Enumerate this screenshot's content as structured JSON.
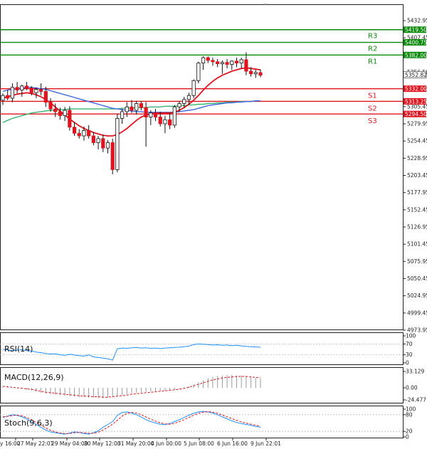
{
  "chart_data": {
    "type": "candlestick",
    "instrument_panels": [
      "main",
      "RSI",
      "MACD",
      "Stoch"
    ],
    "price_axis": {
      "ticks": [
        "5432.95",
        "5407.45",
        "5382.00",
        "5356.50",
        "5330.95",
        "5305.45",
        "5279.95",
        "5254.45",
        "5228.95",
        "5203.45",
        "5177.95",
        "5152.45",
        "5126.95",
        "5101.45",
        "5075.95",
        "5050.45",
        "5024.95",
        "4999.45",
        "4973.95"
      ],
      "min": 4973.95,
      "max": 5432.95
    },
    "levels": [
      {
        "label": "R3",
        "value": 5419.5,
        "value_text": "5419.50",
        "color": "#0a8a0a"
      },
      {
        "label": "R2",
        "value": 5400.75,
        "value_text": "5400.75",
        "color": "#0a8a0a"
      },
      {
        "label": "R1",
        "value": 5382.0,
        "value_text": "5382.00",
        "color": "#0a8a0a"
      },
      {
        "label": "S1",
        "value": 5332.0,
        "value_text": "5332.00",
        "color": "#e0141e"
      },
      {
        "label": "S2",
        "value": 5313.25,
        "value_text": "5313.25",
        "color": "#e0141e"
      },
      {
        "label": "S3",
        "value": 5294.5,
        "value_text": "5294.50",
        "color": "#e0141e"
      }
    ],
    "current_price": {
      "value": 5352.82,
      "value_text": "5352.82"
    },
    "time_axis": [
      "y 16:00",
      "27 May 22:01",
      "29 May 04:00",
      "30 May 12:00",
      "31 May 20:00",
      "4 Jun 00:00",
      "5 Jun 08:00",
      "6 Jun 16:00",
      "9 Jun 22:01"
    ],
    "candles": [
      [
        5315,
        5325,
        5308,
        5322
      ],
      [
        5322,
        5330,
        5315,
        5318
      ],
      [
        5318,
        5340,
        5312,
        5334
      ],
      [
        5334,
        5342,
        5325,
        5330
      ],
      [
        5330,
        5338,
        5320,
        5336
      ],
      [
        5336,
        5342,
        5330,
        5333
      ],
      [
        5333,
        5336,
        5322,
        5326
      ],
      [
        5326,
        5334,
        5318,
        5331
      ],
      [
        5331,
        5340,
        5322,
        5328
      ],
      [
        5328,
        5335,
        5305,
        5312
      ],
      [
        5312,
        5318,
        5298,
        5302
      ],
      [
        5302,
        5310,
        5290,
        5298
      ],
      [
        5298,
        5304,
        5286,
        5292
      ],
      [
        5292,
        5305,
        5284,
        5300
      ],
      [
        5300,
        5306,
        5270,
        5275
      ],
      [
        5275,
        5282,
        5262,
        5266
      ],
      [
        5266,
        5272,
        5258,
        5262
      ],
      [
        5262,
        5276,
        5255,
        5270
      ],
      [
        5270,
        5278,
        5258,
        5262
      ],
      [
        5262,
        5268,
        5248,
        5252
      ],
      [
        5252,
        5262,
        5242,
        5258
      ],
      [
        5258,
        5264,
        5238,
        5244
      ],
      [
        5244,
        5256,
        5236,
        5252
      ],
      [
        5252,
        5258,
        5205,
        5212
      ],
      [
        5212,
        5295,
        5208,
        5288
      ],
      [
        5288,
        5302,
        5280,
        5298
      ],
      [
        5298,
        5312,
        5290,
        5305
      ],
      [
        5305,
        5315,
        5296,
        5300
      ],
      [
        5300,
        5314,
        5294,
        5310
      ],
      [
        5310,
        5314,
        5300,
        5304
      ],
      [
        5304,
        5312,
        5246,
        5290
      ],
      [
        5290,
        5300,
        5278,
        5296
      ],
      [
        5296,
        5302,
        5284,
        5290
      ],
      [
        5290,
        5298,
        5276,
        5280
      ],
      [
        5280,
        5292,
        5266,
        5286
      ],
      [
        5286,
        5296,
        5272,
        5278
      ],
      [
        5278,
        5308,
        5274,
        5305
      ],
      [
        5305,
        5314,
        5298,
        5310
      ],
      [
        5310,
        5320,
        5304,
        5316
      ],
      [
        5316,
        5326,
        5308,
        5322
      ],
      [
        5322,
        5346,
        5318,
        5344
      ],
      [
        5344,
        5372,
        5340,
        5370
      ],
      [
        5370,
        5380,
        5360,
        5378
      ],
      [
        5378,
        5380,
        5370,
        5374
      ],
      [
        5374,
        5378,
        5366,
        5372
      ],
      [
        5372,
        5376,
        5364,
        5369
      ],
      [
        5369,
        5374,
        5354,
        5371
      ],
      [
        5371,
        5376,
        5362,
        5368
      ],
      [
        5368,
        5374,
        5360,
        5373
      ],
      [
        5373,
        5378,
        5364,
        5370
      ],
      [
        5370,
        5378,
        5362,
        5375
      ],
      [
        5375,
        5386,
        5352,
        5358
      ],
      [
        5358,
        5364,
        5350,
        5354
      ],
      [
        5354,
        5360,
        5348,
        5356
      ],
      [
        5356,
        5360,
        5349,
        5352
      ]
    ],
    "ma_fast": [
      5318,
      5320,
      5322,
      5324,
      5325,
      5326,
      5325,
      5323,
      5320,
      5316,
      5311,
      5305,
      5299,
      5293,
      5287,
      5282,
      5277,
      5273,
      5270,
      5267,
      5265,
      5263,
      5262,
      5262,
      5264,
      5268,
      5273,
      5279,
      5285,
      5290,
      5293,
      5295,
      5296,
      5296,
      5296,
      5296,
      5297,
      5300,
      5304,
      5309,
      5315,
      5322,
      5330,
      5337,
      5343,
      5348,
      5352,
      5355,
      5358,
      5360,
      5362,
      5363,
      5362,
      5361,
      5360
    ],
    "ma_mid": [
      5328,
      5330,
      5331,
      5332,
      5333,
      5334,
      5334,
      5333,
      5332,
      5331,
      5329,
      5327,
      5325,
      5323,
      5321,
      5319,
      5317,
      5315,
      5313,
      5311,
      5309,
      5307,
      5305,
      5303,
      5302,
      5301,
      5300,
      5299,
      5298,
      5298,
      5297,
      5297,
      5297,
      5297,
      5297,
      5297,
      5297,
      5298,
      5299,
      5300,
      5301,
      5303,
      5305,
      5307,
      5308,
      5309,
      5310,
      5311,
      5311,
      5312,
      5312,
      5313,
      5313,
      5314,
      5314
    ],
    "ma_slow": [
      5282,
      5285,
      5288,
      5290,
      5292,
      5294,
      5296,
      5297,
      5298,
      5299,
      5300,
      5300,
      5301,
      5301,
      5302,
      5302,
      5302,
      5302,
      5302,
      5302,
      5302,
      5302,
      5302,
      5302,
      5302,
      5303,
      5303,
      5303,
      5304,
      5304,
      5304,
      5305,
      5305,
      5305,
      5306,
      5306,
      5306,
      5307,
      5307,
      5308,
      5308,
      5309,
      5309,
      5310,
      5310,
      5311,
      5311,
      5312,
      5312,
      5312,
      5313,
      5313,
      5313,
      5314,
      5314
    ],
    "rsi": {
      "title": "RSI(14)",
      "ticks": [
        "100",
        "70",
        "30",
        "0"
      ],
      "values": [
        50,
        48,
        46,
        47,
        49,
        45,
        44,
        40,
        38,
        35,
        33,
        34,
        30,
        28,
        32,
        29,
        27,
        25,
        30,
        22,
        20,
        18,
        15,
        10,
        52,
        55,
        54,
        56,
        57,
        55,
        56,
        54,
        55,
        53,
        55,
        56,
        57,
        58,
        60,
        62,
        68,
        70,
        69,
        68,
        66,
        67,
        65,
        66,
        64,
        65,
        63,
        61,
        60,
        59,
        58
      ]
    },
    "macd": {
      "title": "MACD(12,26,9)",
      "ticks": [
        "33.129",
        "0.00",
        "-24.477"
      ],
      "histogram": [
        2,
        1,
        0,
        -1,
        -2,
        -4,
        -6,
        -8,
        -10,
        -12,
        -13,
        -14,
        -15,
        -16,
        -17,
        -18,
        -19,
        -19,
        -20,
        -20,
        -21,
        -21,
        -20,
        -19,
        -17,
        -15,
        -13,
        -11,
        -10,
        -9,
        -8,
        -7,
        -7,
        -6,
        -6,
        -5,
        -4,
        -2,
        0,
        3,
        7,
        11,
        15,
        19,
        22,
        24,
        25,
        26,
        26,
        25,
        25,
        24,
        22,
        20,
        18
      ],
      "signal": [
        3,
        2,
        1,
        0,
        -1,
        -2,
        -3,
        -5,
        -7,
        -9,
        -10,
        -11,
        -12,
        -13,
        -14,
        -15,
        -16,
        -17,
        -17,
        -18,
        -18,
        -19,
        -19,
        -18,
        -17,
        -16,
        -15,
        -13,
        -12,
        -11,
        -10,
        -9,
        -8,
        -7,
        -6,
        -5,
        -4,
        -3,
        -1,
        1,
        4,
        7,
        10,
        13,
        16,
        18,
        20,
        21,
        22,
        23,
        23,
        23,
        22,
        21,
        20
      ]
    },
    "stoch": {
      "title": "Stoch(9,6,3)",
      "ticks": [
        "100",
        "80",
        "20",
        "0"
      ],
      "k": [
        70,
        75,
        80,
        78,
        72,
        65,
        55,
        45,
        35,
        25,
        18,
        15,
        12,
        10,
        14,
        18,
        16,
        12,
        10,
        15,
        22,
        35,
        45,
        55,
        78,
        88,
        90,
        86,
        80,
        72,
        62,
        55,
        50,
        46,
        44,
        48,
        55,
        62,
        70,
        78,
        85,
        90,
        92,
        90,
        86,
        80,
        72,
        65,
        58,
        52,
        48,
        45,
        42,
        38,
        35
      ],
      "d": [
        72,
        74,
        77,
        78,
        76,
        70,
        62,
        52,
        42,
        32,
        24,
        18,
        14,
        12,
        12,
        15,
        16,
        15,
        13,
        13,
        17,
        25,
        35,
        46,
        60,
        75,
        85,
        88,
        86,
        80,
        72,
        64,
        57,
        51,
        47,
        46,
        49,
        55,
        62,
        70,
        78,
        85,
        89,
        91,
        89,
        85,
        79,
        72,
        66,
        60,
        54,
        50,
        46,
        42,
        39
      ]
    }
  }
}
